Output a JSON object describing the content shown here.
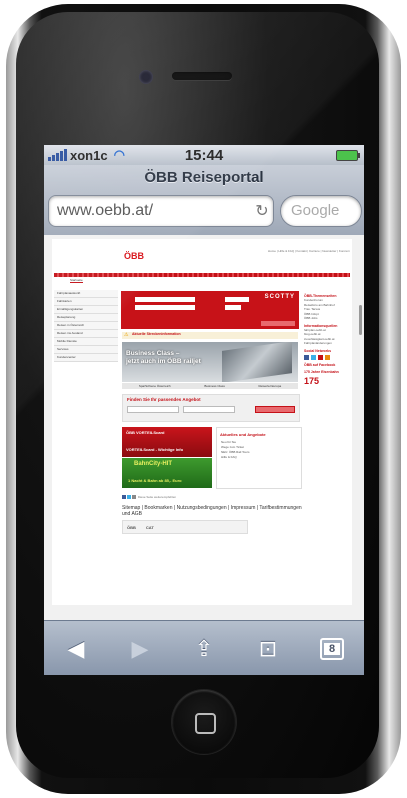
{
  "status_bar": {
    "carrier": "xon1c",
    "time": "15:44"
  },
  "browser": {
    "page_title": "ÖBB Reiseportal",
    "url": "www.oebb.at/",
    "search_placeholder": "Google",
    "tab_count": "8"
  },
  "website": {
    "logo": "ÖBB",
    "top_links": "Home | Hilfe & FAQ | Kontakt | Karriere | Newsletter | Konzern",
    "tab_label": "Startseite",
    "left_nav": [
      "Fahrplanauskunft",
      "Fahrkarten",
      "Ermäßigungskarten",
      "Reiseplanung",
      "Reisen in Österreich",
      "Reisen ins Ausland",
      "Mobile Dienste",
      "Services",
      "Kundencenter"
    ],
    "scotty": "SCOTTY",
    "info_label": "Aktuelle Streckeninformation",
    "banner_text": "Business Class –\njetzt auch im ÖBB railjet",
    "banner_tabs": [
      "SparSchiene Österreich",
      "Business Class",
      "Reiseziel Europa"
    ],
    "finder_title": "Finden Sie Ihr passendes Angebot",
    "promo1_title": "ÖBB VORTEILScard",
    "promo1_sub": "VORTEILScard - Wichtige Info",
    "promo2_title": "BahnCity-HIT",
    "promo2_sub": "1 Nacht & Bahn ab 85,- Euro",
    "news_title": "Aktuelles und Angebote",
    "news_items": [
      "Neu für Sie",
      "Wege zum Ticket",
      "NEU: ÖBB Rail Tours",
      "Hilfe & FAQ"
    ],
    "right_col": {
      "themen_title": "ÖBB-Themenseiten",
      "themen_items": [
        "KundenForum",
        "Reisebüro am Bahnhof",
        "Trav. Tarsus",
        "ÖBB Infopt",
        "ÖBB Jobs"
      ],
      "info_title": "Informationsquellen",
      "info_items": [
        "fahrplan.oebb.at",
        "blog.oebb.at",
        "zuverlässigkeit.oebb.at",
        "Fahrplanänderungen"
      ],
      "social_title": "Social Networks",
      "facebook": "ÖBB auf Facebook",
      "anniv_title": "175 Jahre Eisenbahn",
      "anniv_number": "175"
    },
    "share_text": "Diese Seite weiterempfehlen",
    "footer_links": "Sitemap | Bookmarken | Nutzungsbedingungen | Impressum | Tarifbestimmungen und AGB",
    "partners": [
      "ÖBB",
      "CAT"
    ]
  }
}
